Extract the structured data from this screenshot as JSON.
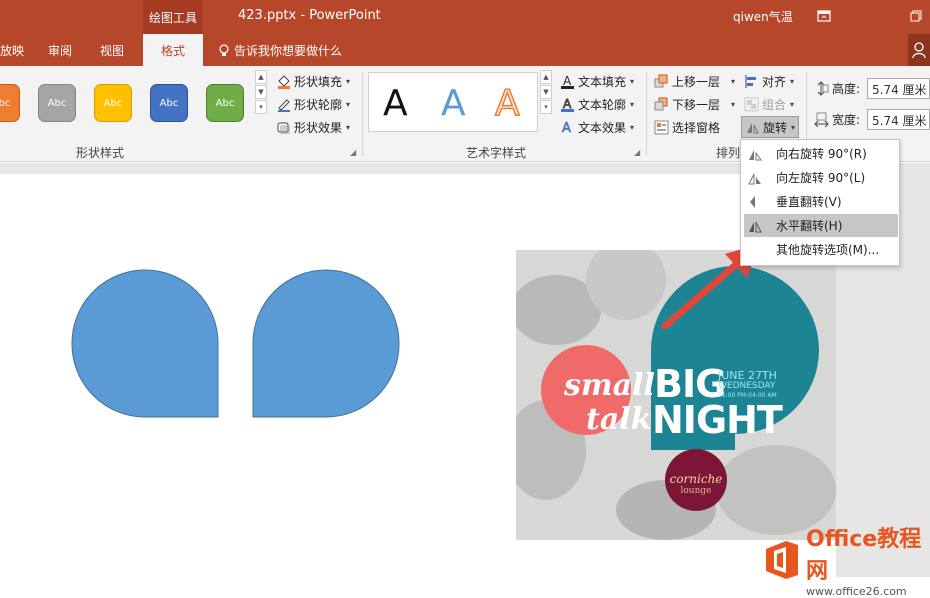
{
  "titlebar": {
    "context_group": "绘图工具",
    "doc_title": "423.pptx - PowerPoint",
    "user": "qiwen气温",
    "restore_icon": "ribbon-display-icon",
    "window_icon": "restore-window-icon"
  },
  "tabs": {
    "items": [
      {
        "label": "放映"
      },
      {
        "label": "审阅"
      },
      {
        "label": "视图"
      }
    ],
    "active": "格式",
    "tellme": "告诉我你想要做什么"
  },
  "shape_styles": {
    "swatch_label": "Abc",
    "colors": [
      "#ed7d31",
      "#a5a5a5",
      "#ffc000",
      "#4472c4",
      "#70ad47"
    ],
    "fill": "形状填充",
    "outline": "形状轮廓",
    "effects": "形状效果",
    "group_label": "形状样式"
  },
  "wordart": {
    "letter": "A",
    "text_fill": "文本填充",
    "text_outline": "文本轮廓",
    "text_effects": "文本效果",
    "group_label": "艺术字样式"
  },
  "arrange": {
    "bring_forward": "上移一层",
    "send_backward": "下移一层",
    "selection_pane": "选择窗格",
    "align": "对齐",
    "group": "组合",
    "rotate": "旋转",
    "group_label": "排列"
  },
  "size": {
    "height_label": "高度:",
    "height_value": "5.74 厘米",
    "width_label": "宽度:",
    "width_value": "5.74 厘米"
  },
  "rotate_menu": {
    "items": [
      {
        "label": "向右旋转 90°(R)"
      },
      {
        "label": "向左旋转 90°(L)"
      },
      {
        "label": "垂直翻转(V)"
      },
      {
        "label": "水平翻转(H)"
      },
      {
        "label": "其他旋转选项(M)..."
      }
    ]
  },
  "poster": {
    "small": "small",
    "talk": "talk",
    "big": "BIG",
    "night": "NIGHT",
    "date": "JUNE 27TH",
    "weekday": "WEDNESDAY",
    "time": "21:00 PM-04:00 AM",
    "venue": "corniche",
    "venue_sub": "lounge"
  },
  "watermark": {
    "brand": "Office教程网",
    "url": "www.office26.com"
  },
  "colors": {
    "accent": "#b7472a",
    "shape_fill": "#5b9bd5",
    "arrow": "#e0473b"
  }
}
